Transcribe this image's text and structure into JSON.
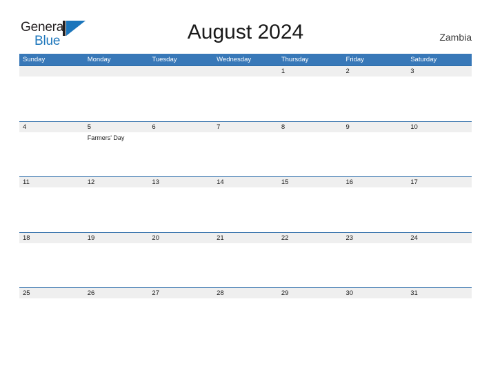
{
  "brand": {
    "name_part1": "General",
    "name_part2": "Blue",
    "mark": "flag-triangle-icon"
  },
  "header": {
    "title": "August 2024",
    "country": "Zambia"
  },
  "calendar": {
    "weekdays": [
      "Sunday",
      "Monday",
      "Tuesday",
      "Wednesday",
      "Thursday",
      "Friday",
      "Saturday"
    ],
    "header_bg": "#3878b8",
    "row_divider": "#2e6da8",
    "band_bg": "#efefef",
    "weeks": [
      {
        "days": [
          {
            "number": "",
            "event": "",
            "empty": true
          },
          {
            "number": "",
            "event": "",
            "empty": true
          },
          {
            "number": "",
            "event": "",
            "empty": true
          },
          {
            "number": "",
            "event": "",
            "empty": true
          },
          {
            "number": "1",
            "event": "",
            "empty": false
          },
          {
            "number": "2",
            "event": "",
            "empty": false
          },
          {
            "number": "3",
            "event": "",
            "empty": false
          }
        ]
      },
      {
        "days": [
          {
            "number": "4",
            "event": "",
            "empty": false
          },
          {
            "number": "5",
            "event": "Farmers' Day",
            "empty": false
          },
          {
            "number": "6",
            "event": "",
            "empty": false
          },
          {
            "number": "7",
            "event": "",
            "empty": false
          },
          {
            "number": "8",
            "event": "",
            "empty": false
          },
          {
            "number": "9",
            "event": "",
            "empty": false
          },
          {
            "number": "10",
            "event": "",
            "empty": false
          }
        ]
      },
      {
        "days": [
          {
            "number": "11",
            "event": "",
            "empty": false
          },
          {
            "number": "12",
            "event": "",
            "empty": false
          },
          {
            "number": "13",
            "event": "",
            "empty": false
          },
          {
            "number": "14",
            "event": "",
            "empty": false
          },
          {
            "number": "15",
            "event": "",
            "empty": false
          },
          {
            "number": "16",
            "event": "",
            "empty": false
          },
          {
            "number": "17",
            "event": "",
            "empty": false
          }
        ]
      },
      {
        "days": [
          {
            "number": "18",
            "event": "",
            "empty": false
          },
          {
            "number": "19",
            "event": "",
            "empty": false
          },
          {
            "number": "20",
            "event": "",
            "empty": false
          },
          {
            "number": "21",
            "event": "",
            "empty": false
          },
          {
            "number": "22",
            "event": "",
            "empty": false
          },
          {
            "number": "23",
            "event": "",
            "empty": false
          },
          {
            "number": "24",
            "event": "",
            "empty": false
          }
        ]
      },
      {
        "days": [
          {
            "number": "25",
            "event": "",
            "empty": false
          },
          {
            "number": "26",
            "event": "",
            "empty": false
          },
          {
            "number": "27",
            "event": "",
            "empty": false
          },
          {
            "number": "28",
            "event": "",
            "empty": false
          },
          {
            "number": "29",
            "event": "",
            "empty": false
          },
          {
            "number": "30",
            "event": "",
            "empty": false
          },
          {
            "number": "31",
            "event": "",
            "empty": false
          }
        ]
      }
    ]
  }
}
